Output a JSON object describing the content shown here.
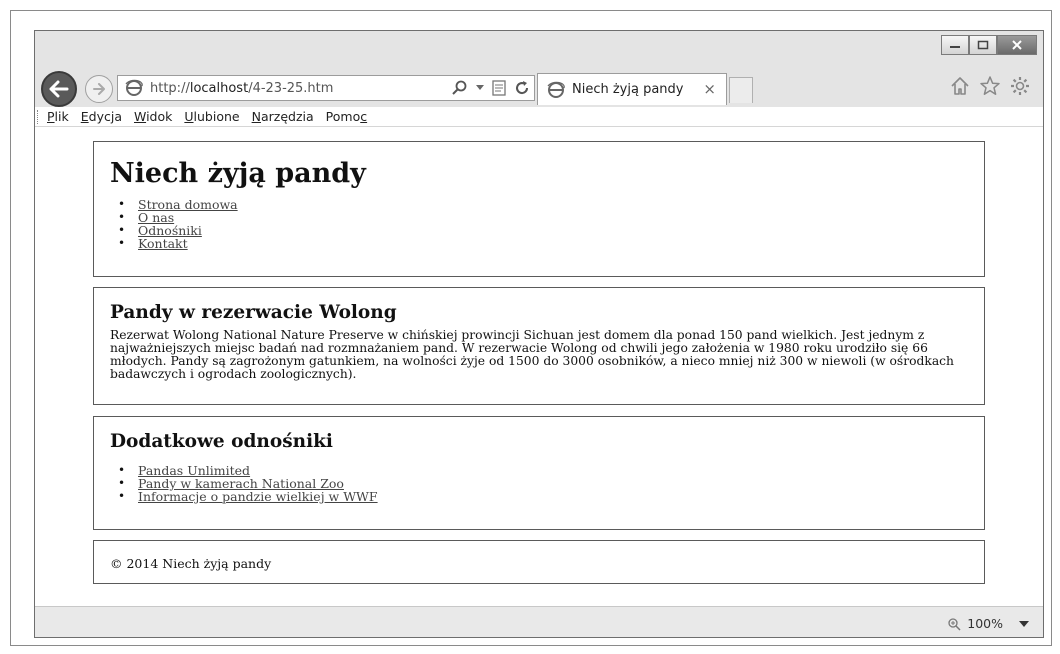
{
  "browser": {
    "url_prefix": "http://",
    "url_host": "localhost",
    "url_path": "/4-23-25.htm",
    "tab_title": "Niech żyją pandy",
    "tab_close": "×",
    "zoom": "100%"
  },
  "menu": [
    "Plik",
    "Edycja",
    "Widok",
    "Ulubione",
    "Narzędzia",
    "Pomoc"
  ],
  "header": {
    "title": "Niech żyją pandy",
    "nav": [
      "Strona domowa",
      "O nas",
      "Odnośniki",
      "Kontakt"
    ]
  },
  "article": {
    "title": "Pandy w rezerwacie Wolong",
    "lines": [
      "Rezerwat Wolong National Nature Preserve w chińskiej prowincji Sichuan jest domem dla ponad 150 pand wielkich. Jest jednym z",
      "najważniejszych miejsc badań nad rozmnażaniem pand. W rezerwacie Wolong od chwili jego założenia w 1980 roku urodziło się 66",
      "młodych. Pandy są zagrożonym gatunkiem, na wolności żyje od 1500 do 3000 osobników, a nieco mniej niż 300 w niewoli (w ośrodkach",
      "badawczych i ogrodach zoologicznych)."
    ]
  },
  "extra": {
    "title": "Dodatkowe odnośniki",
    "links": [
      "Pandas Unlimited",
      "Pandy w kamerach National Zoo",
      "Informacje o pandzie wielkiej w WWF"
    ]
  },
  "footer": {
    "text": "© 2014 Niech żyją pandy"
  },
  "icons": {
    "back": "back-arrow-icon",
    "forward": "forward-arrow-icon",
    "page": "ie-logo-icon",
    "search": "search-icon",
    "compat": "compatibility-view-icon",
    "refresh": "refresh-icon",
    "home": "home-icon",
    "favorites": "star-icon",
    "tools": "gear-icon",
    "zoom": "magnifier-icon"
  }
}
